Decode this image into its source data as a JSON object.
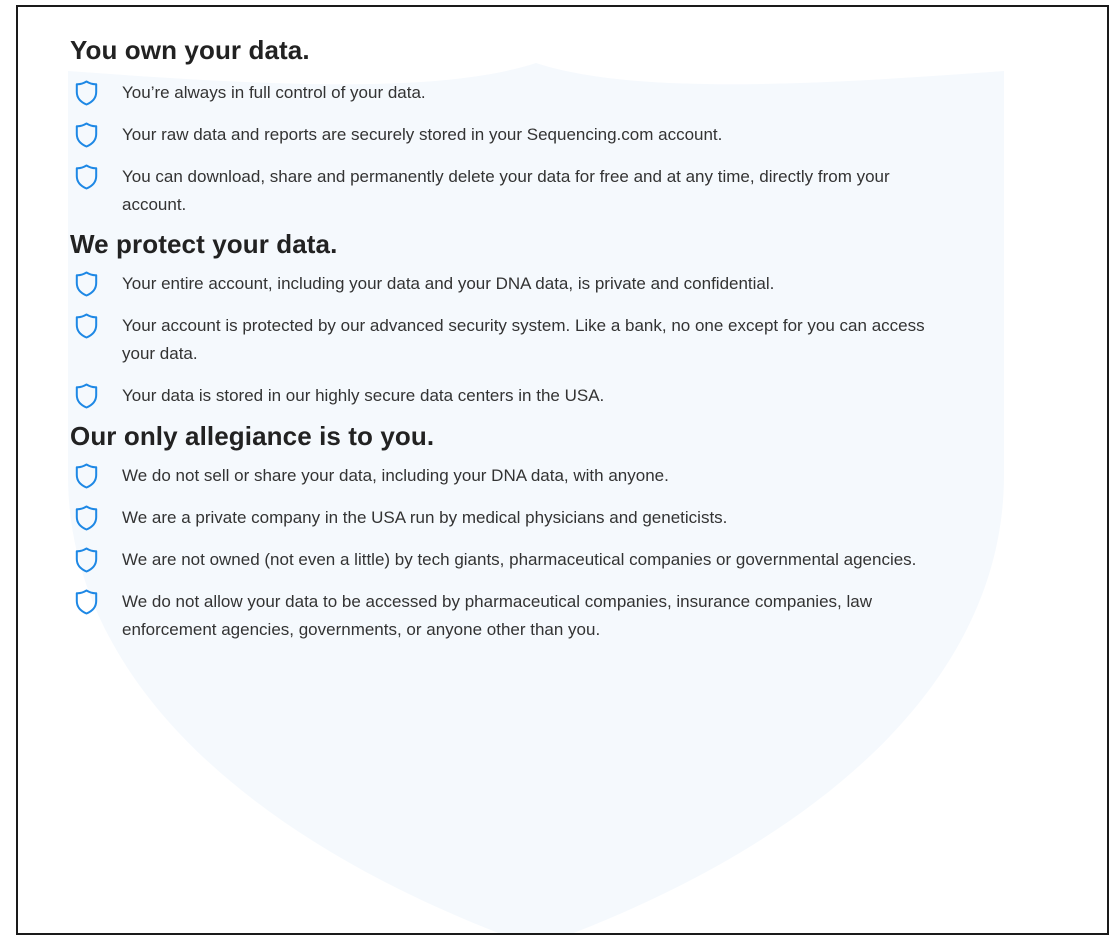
{
  "colors": {
    "icon_stroke": "#1e88e5",
    "heading": "#222222",
    "body_text": "#333333",
    "background_shield": "#f5f9fd",
    "frame_border": "#1a1a1a"
  },
  "icon_name": "shield-icon",
  "sections": [
    {
      "title": "You own your data.",
      "items": [
        "You’re always in full control of your data.",
        "Your raw data and reports are securely stored in your Sequencing.com account.",
        "You can download, share and permanently delete your data for free and at any time, directly from your account."
      ]
    },
    {
      "title": "We protect your data.",
      "items": [
        "Your entire account, including your data and your DNA data, is private and confidential.",
        "Your account is protected by our advanced security system. Like a bank, no one except for you can access your data.",
        "Your data is stored in our highly secure data centers in the USA."
      ]
    },
    {
      "title": "Our only allegiance is to you.",
      "items": [
        "We do not sell or share your data, including your DNA data, with anyone.",
        "We are a private company in the USA run by medical physicians and geneticists.",
        "We are not owned (not even a little) by tech giants, pharmaceutical companies or governmental agencies.",
        "We do not allow your data to be accessed by pharmaceutical companies, insurance companies, law enforcement agencies, governments, or anyone other than you."
      ]
    }
  ]
}
